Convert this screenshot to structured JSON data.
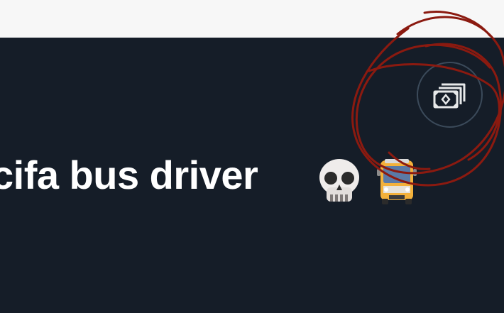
{
  "profile": {
    "name_visible": "cifa bus driver"
  },
  "icons": {
    "tip_button": "money-icon",
    "skull": "skull-emoji",
    "bus": "bus-emoji"
  },
  "colors": {
    "background": "#151d28",
    "top_bar": "#f7f7f7",
    "button_border": "#3b4a5a",
    "icon": "#e7e9ea",
    "annotation": "#8b1a10"
  }
}
